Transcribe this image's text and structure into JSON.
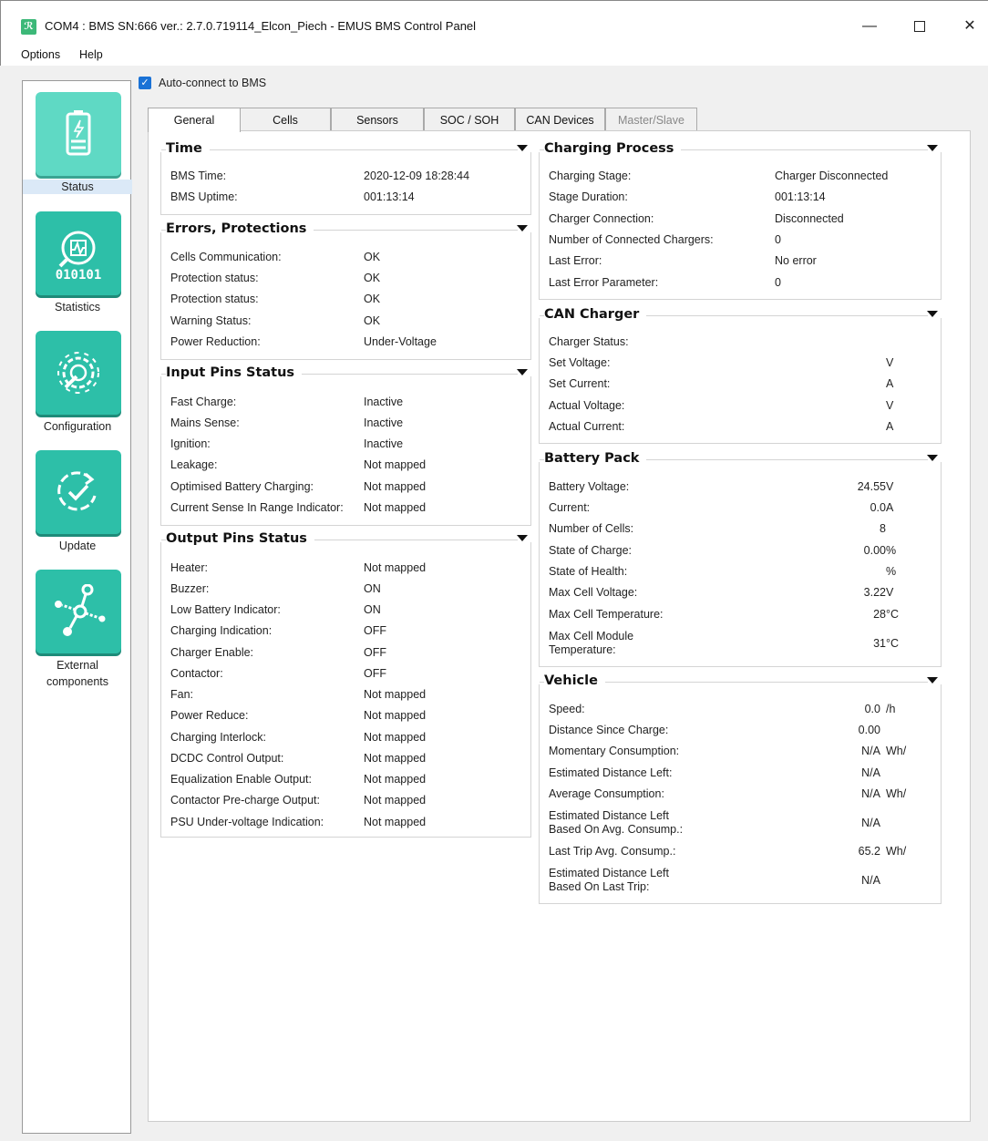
{
  "window": {
    "title": "COM4 : BMS SN:666 ver.: 2.7.0.719114_Elcon_Piech - EMUS BMS Control Panel",
    "minimize": "—",
    "close": "✕"
  },
  "menu": {
    "options": "Options",
    "help": "Help"
  },
  "nav": {
    "status": "Status",
    "statistics": "Statistics",
    "configuration": "Configuration",
    "update": "Update",
    "external1": "External",
    "external2": "components",
    "stat_digits": "010101"
  },
  "autoconnect": {
    "label": "Auto-connect to BMS",
    "checked": true
  },
  "tabs": {
    "general": "General",
    "cells": "Cells",
    "sensors": "Sensors",
    "soc": "SOC / SOH",
    "can": "CAN Devices",
    "master": "Master/Slave"
  },
  "time": {
    "title": "Time",
    "rows": [
      {
        "label": "BMS Time:",
        "value": "2020-12-09 18:28:44"
      },
      {
        "label": "BMS Uptime:",
        "value": "001:13:14"
      }
    ]
  },
  "errors": {
    "title": "Errors, Protections",
    "rows": [
      {
        "label": "Cells Communication:",
        "value": "OK"
      },
      {
        "label": "Protection status:",
        "value": "OK"
      },
      {
        "label": "Protection status:",
        "value": "OK"
      },
      {
        "label": "Warning Status:",
        "value": "OK"
      },
      {
        "label": "Power Reduction:",
        "value": "Under-Voltage"
      }
    ]
  },
  "input_pins": {
    "title": "Input Pins Status",
    "rows": [
      {
        "label": "Fast Charge:",
        "value": "Inactive"
      },
      {
        "label": "Mains Sense:",
        "value": "Inactive"
      },
      {
        "label": "Ignition:",
        "value": "Inactive"
      },
      {
        "label": "Leakage:",
        "value": "Not mapped"
      },
      {
        "label": "Optimised Battery Charging:",
        "value": "Not mapped"
      },
      {
        "label": "Current Sense In Range Indicator:",
        "value": "Not mapped"
      }
    ]
  },
  "output_pins": {
    "title": "Output Pins Status",
    "rows": [
      {
        "label": "Heater:",
        "value": "Not mapped"
      },
      {
        "label": "Buzzer:",
        "value": "ON"
      },
      {
        "label": "Low Battery Indicator:",
        "value": "ON"
      },
      {
        "label": "Charging Indication:",
        "value": "OFF"
      },
      {
        "label": "Charger Enable:",
        "value": "OFF"
      },
      {
        "label": "Contactor:",
        "value": "OFF"
      },
      {
        "label": "Fan:",
        "value": "Not mapped"
      },
      {
        "label": "Power Reduce:",
        "value": "Not mapped"
      },
      {
        "label": "Charging Interlock:",
        "value": "Not mapped"
      },
      {
        "label": "DCDC Control Output:",
        "value": "Not mapped"
      },
      {
        "label": "Equalization Enable Output:",
        "value": "Not mapped"
      },
      {
        "label": "Contactor Pre-charge Output:",
        "value": "Not mapped"
      },
      {
        "label": "PSU Under-voltage Indication:",
        "value": "Not mapped"
      }
    ]
  },
  "charging": {
    "title": "Charging Process",
    "rows": [
      {
        "label": "Charging Stage:",
        "value": "Charger Disconnected"
      },
      {
        "label": "Stage Duration:",
        "value": "001:13:14"
      },
      {
        "label": "Charger Connection:",
        "value": "Disconnected"
      },
      {
        "label": "Number of Connected Chargers:",
        "value": "0"
      },
      {
        "label": "Last Error:",
        "value": "No error"
      },
      {
        "label": "Last Error Parameter:",
        "value": "0"
      }
    ]
  },
  "can_charger": {
    "title": "CAN Charger",
    "rows": [
      {
        "label": "Charger Status:",
        "value": "",
        "unit": ""
      },
      {
        "label": "Set Voltage:",
        "value": "",
        "unit": "V"
      },
      {
        "label": "Set Current:",
        "value": "",
        "unit": "A"
      },
      {
        "label": "Actual Voltage:",
        "value": "",
        "unit": "V"
      },
      {
        "label": "Actual Current:",
        "value": "",
        "unit": "A"
      }
    ]
  },
  "battery": {
    "title": "Battery Pack",
    "rows": [
      {
        "label": "Battery Voltage:",
        "value": "24.55",
        "unit": "V"
      },
      {
        "label": "Current:",
        "value": "0.0",
        "unit": "A"
      },
      {
        "label": "Number of Cells:",
        "value": "8",
        "unit": ""
      },
      {
        "label": "State of Charge:",
        "value": "0.00",
        "unit": "%"
      },
      {
        "label": "State of Health:",
        "value": "",
        "unit": "%"
      },
      {
        "label": "Max Cell Voltage:",
        "value": "3.22",
        "unit": "V"
      },
      {
        "label": "Max Cell Temperature:",
        "value": "28",
        "unit": "°C"
      },
      {
        "label1": "Max Cell Module",
        "label2": "Temperature:",
        "value": "31",
        "unit": "°C"
      }
    ]
  },
  "vehicle": {
    "title": "Vehicle",
    "rows": [
      {
        "label": "Speed:",
        "value": "0.0",
        "unit": "/h"
      },
      {
        "label": "Distance Since Charge:",
        "value": "0.00",
        "unit": ""
      },
      {
        "label": "Momentary Consumption:",
        "value": "N/A",
        "unit": "Wh/"
      },
      {
        "label": "Estimated Distance Left:",
        "value": "N/A",
        "unit": ""
      },
      {
        "label": "Average Consumption:",
        "value": "N/A",
        "unit": "Wh/"
      },
      {
        "label1": "Estimated Distance Left",
        "label2": "Based On Avg. Consump.:",
        "value": "N/A",
        "unit": ""
      },
      {
        "label": "Last Trip Avg. Consump.:",
        "value": "65.2",
        "unit": "Wh/"
      },
      {
        "label1": "Estimated Distance Left",
        "label2": "Based On Last Trip:",
        "value": "N/A",
        "unit": ""
      }
    ]
  }
}
